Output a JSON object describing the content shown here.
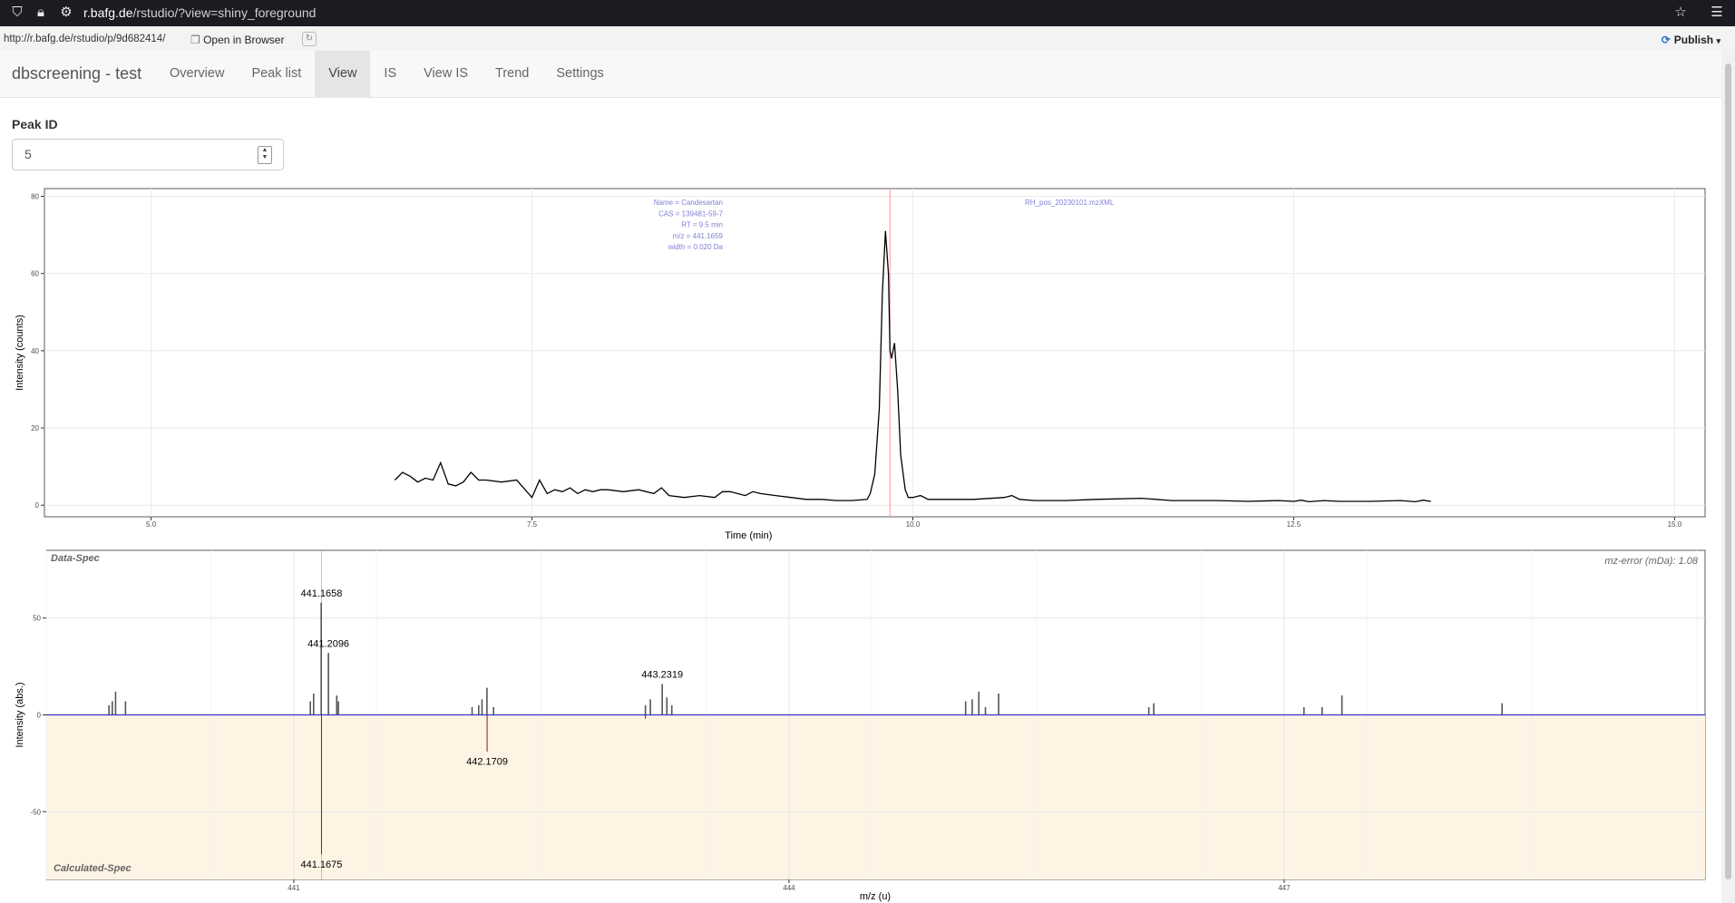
{
  "browser": {
    "url_domain": "r.bafg.de",
    "url_path": "/rstudio/?view=shiny_foreground"
  },
  "rstudio": {
    "path": "http://r.bafg.de/rstudio/p/9d682414/",
    "open_label": "Open in Browser",
    "publish_label": "Publish"
  },
  "app": {
    "title": "dbscreening - test",
    "tabs": [
      {
        "label": "Overview",
        "active": false
      },
      {
        "label": "Peak list",
        "active": false
      },
      {
        "label": "View",
        "active": true
      },
      {
        "label": "IS",
        "active": false
      },
      {
        "label": "View IS",
        "active": false
      },
      {
        "label": "Trend",
        "active": false
      },
      {
        "label": "Settings",
        "active": false
      }
    ]
  },
  "peak": {
    "label": "Peak ID",
    "value": "5"
  },
  "chart_data": [
    {
      "type": "line",
      "xlabel": "Time (min)",
      "ylabel": "Intensity (counts)",
      "xlim": [
        4.3,
        15.2
      ],
      "ylim": [
        -3,
        82
      ],
      "xticks": [
        5.0,
        7.5,
        10.0,
        12.5,
        15.0
      ],
      "xtick_labels": [
        "5.0",
        "7.5",
        "10.0",
        "12.5",
        "15.0"
      ],
      "yticks": [
        0,
        20,
        40,
        60,
        80
      ],
      "grid": true,
      "annotation_lines": [
        "Name = Candesartan",
        "CAS = 139481-59-7",
        "RT = 9.5 min",
        "m/z = 441.1659",
        "width = 0.020 Da"
      ],
      "file_label": "RH_pos_20230101.mzXML",
      "marker_rt": 9.85,
      "colors": {
        "line": "#000000",
        "annotation": "#8080d8",
        "marker": "#ff9e9e"
      },
      "x": [
        6.6,
        6.65,
        6.7,
        6.75,
        6.8,
        6.85,
        6.9,
        6.95,
        7.0,
        7.05,
        7.1,
        7.15,
        7.2,
        7.3,
        7.4,
        7.5,
        7.55,
        7.6,
        7.65,
        7.7,
        7.75,
        7.8,
        7.85,
        7.9,
        7.95,
        8.0,
        8.1,
        8.2,
        8.3,
        8.35,
        8.4,
        8.5,
        8.6,
        8.7,
        8.75,
        8.8,
        8.9,
        8.95,
        9.0,
        9.1,
        9.2,
        9.3,
        9.4,
        9.5,
        9.6,
        9.7,
        9.72,
        9.75,
        9.78,
        9.8,
        9.82,
        9.84,
        9.85,
        9.86,
        9.88,
        9.9,
        9.92,
        9.95,
        9.97,
        10.0,
        10.05,
        10.1,
        10.15,
        10.2,
        10.4,
        10.6,
        10.65,
        10.7,
        10.8,
        11.0,
        11.2,
        11.5,
        11.7,
        12.0,
        12.2,
        12.4,
        12.5,
        12.55,
        12.6,
        12.7,
        12.8,
        13.0,
        13.2,
        13.3,
        13.35,
        13.4
      ],
      "y": [
        6.5,
        8.5,
        7.5,
        6,
        7,
        6.5,
        11,
        5.5,
        5,
        6,
        8.5,
        6.5,
        6.5,
        6,
        6.5,
        2,
        6.5,
        3,
        4,
        3.5,
        4.5,
        3,
        4,
        3.5,
        4,
        4,
        3.5,
        4,
        3,
        4.5,
        2.5,
        2,
        2.5,
        2,
        3.5,
        3.5,
        2.5,
        3.5,
        3,
        2.5,
        2,
        1.5,
        1.5,
        1.2,
        1.2,
        1.5,
        3,
        8,
        25,
        55,
        71,
        60,
        40,
        38,
        42,
        30,
        13,
        4,
        2,
        2,
        2.5,
        1.5,
        1.5,
        1.5,
        1.5,
        2,
        2.5,
        1.5,
        1.2,
        1.2,
        1.5,
        1.8,
        1.2,
        1.2,
        1.0,
        1.2,
        1.0,
        1.3,
        0.9,
        1.2,
        1.0,
        1.0,
        1.2,
        0.9,
        1.3,
        1.0
      ]
    },
    {
      "type": "bar",
      "xlabel": "m/z (u)",
      "ylabel": "Intensity (abs.)",
      "xlim": [
        439.5,
        449.55
      ],
      "ylim": [
        -85,
        85
      ],
      "xticks": [
        441,
        444,
        447
      ],
      "yticks": [
        -50,
        0,
        50
      ],
      "grid": true,
      "top_label": "Data-Spec",
      "bottom_label": "Calculated-Spec",
      "mz_error": "mz-error (mDa): 1.08",
      "marker_mz": 441.1675,
      "colors": {
        "baseline": "#3333cc",
        "calculated_fill": "#fdf4e4",
        "marker": "#8b1a1a",
        "bars": "#555555"
      },
      "data_bars": [
        {
          "mz": 439.88,
          "value": 5
        },
        {
          "mz": 439.9,
          "value": 7
        },
        {
          "mz": 439.92,
          "value": 12
        },
        {
          "mz": 439.98,
          "value": 7
        },
        {
          "mz": 441.1,
          "value": 7
        },
        {
          "mz": 441.12,
          "value": 11
        },
        {
          "mz": 441.1658,
          "value": 58
        },
        {
          "mz": 441.2096,
          "value": 32
        },
        {
          "mz": 441.26,
          "value": 10
        },
        {
          "mz": 441.27,
          "value": 7
        },
        {
          "mz": 442.08,
          "value": 4
        },
        {
          "mz": 442.12,
          "value": 5
        },
        {
          "mz": 442.14,
          "value": 8
        },
        {
          "mz": 442.17,
          "value": 14
        },
        {
          "mz": 442.21,
          "value": 4
        },
        {
          "mz": 443.13,
          "value": 5
        },
        {
          "mz": 443.16,
          "value": 8
        },
        {
          "mz": 443.2319,
          "value": 16
        },
        {
          "mz": 443.26,
          "value": 9
        },
        {
          "mz": 443.29,
          "value": 5
        },
        {
          "mz": 445.07,
          "value": 7
        },
        {
          "mz": 445.11,
          "value": 8
        },
        {
          "mz": 445.15,
          "value": 12
        },
        {
          "mz": 445.19,
          "value": 4
        },
        {
          "mz": 445.27,
          "value": 11
        },
        {
          "mz": 446.18,
          "value": 4
        },
        {
          "mz": 446.21,
          "value": 6
        },
        {
          "mz": 447.12,
          "value": 4
        },
        {
          "mz": 447.23,
          "value": 4
        },
        {
          "mz": 447.35,
          "value": 10
        },
        {
          "mz": 448.32,
          "value": 6
        }
      ],
      "calc_bars": [
        {
          "mz": 441.1675,
          "value": -72
        },
        {
          "mz": 442.1709,
          "value": -19
        },
        {
          "mz": 443.13,
          "value": -2
        }
      ],
      "peak_labels": [
        {
          "text": "441.1658",
          "mz": 441.1675,
          "value": 63
        },
        {
          "text": "441.2096",
          "mz": 441.2096,
          "value": 37
        },
        {
          "text": "443.2319",
          "mz": 443.2319,
          "value": 21
        },
        {
          "text": "442.1709",
          "mz": 442.1709,
          "value": -24
        },
        {
          "text": "441.1675",
          "mz": 441.1675,
          "value": -77
        }
      ]
    }
  ]
}
